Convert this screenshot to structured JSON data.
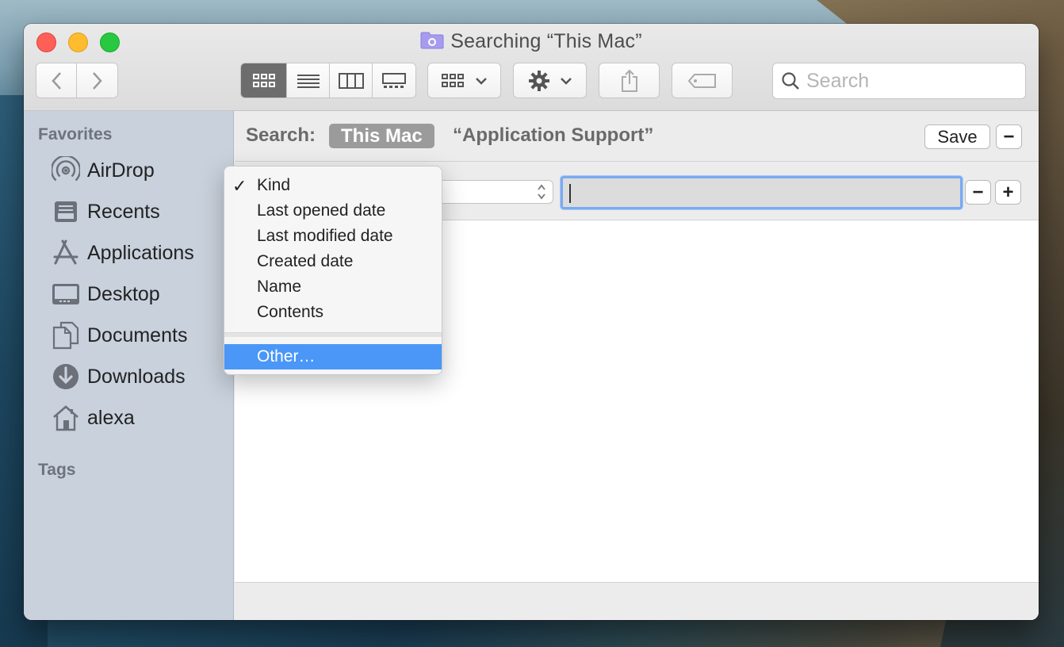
{
  "window": {
    "title": "Searching “This Mac”"
  },
  "toolbar": {
    "back_icon": "chevron-left-icon",
    "forward_icon": "chevron-right-icon",
    "view_modes": [
      "icon-view-icon",
      "list-view-icon",
      "column-view-icon",
      "gallery-view-icon"
    ],
    "active_view": "icon-view-icon",
    "group_icon": "group-by-icon",
    "action_icon": "gear-icon",
    "share_icon": "share-icon",
    "tag_icon": "tag-icon",
    "search_placeholder": "Search"
  },
  "sidebar": {
    "favorites_label": "Favorites",
    "tags_label": "Tags",
    "items": [
      {
        "label": "AirDrop",
        "icon": "airdrop-icon"
      },
      {
        "label": "Recents",
        "icon": "recents-icon"
      },
      {
        "label": "Applications",
        "icon": "applications-icon"
      },
      {
        "label": "Desktop",
        "icon": "desktop-icon"
      },
      {
        "label": "Documents",
        "icon": "documents-icon"
      },
      {
        "label": "Downloads",
        "icon": "downloads-icon"
      },
      {
        "label": "alexa",
        "icon": "home-icon"
      }
    ]
  },
  "search_scope": {
    "label": "Search:",
    "this_mac": "This Mac",
    "folder": "“Application Support”",
    "save_label": "Save",
    "remove_label": "−"
  },
  "rule": {
    "remove_label": "−",
    "add_label": "+"
  },
  "attribute_menu": {
    "items": [
      {
        "label": "Kind",
        "checked": true
      },
      {
        "label": "Last opened date",
        "checked": false
      },
      {
        "label": "Last modified date",
        "checked": false
      },
      {
        "label": "Created date",
        "checked": false
      },
      {
        "label": "Name",
        "checked": false
      },
      {
        "label": "Contents",
        "checked": false
      }
    ],
    "other_label": "Other…",
    "check_mark": "✓"
  }
}
